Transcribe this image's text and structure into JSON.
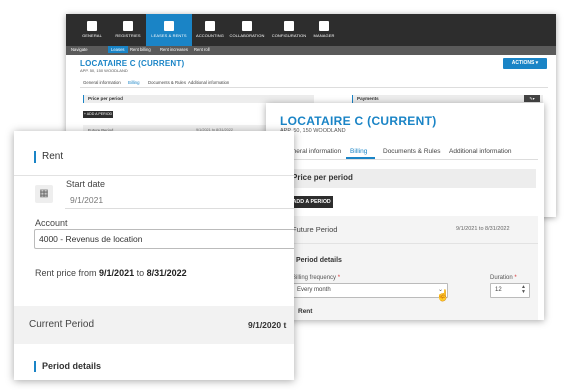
{
  "back_window": {
    "nav": [
      {
        "label": "GENERAL",
        "icon": "monitor-icon"
      },
      {
        "label": "REGISTRIES",
        "icon": "folder-icon"
      },
      {
        "label": "LEASES & RENTS",
        "icon": "lease-icon"
      },
      {
        "label": "ACCOUNTING",
        "icon": "document-icon"
      },
      {
        "label": "COLLABORATION",
        "icon": "collaboration-icon"
      },
      {
        "label": "CONFIGURATION",
        "icon": "gear-icon"
      },
      {
        "label": "MANAGER",
        "icon": "user-icon"
      }
    ],
    "subnav": [
      "Navigate",
      "Leases",
      "Rent billing",
      "Rent increases",
      "Rent roll"
    ],
    "title": "LOCATAIRE C (CURRENT)",
    "subtitle": "APP. 50, 150 WOODLAND",
    "actions_label": "ACTIONS",
    "tabs": [
      "General information",
      "Billing",
      "Documents & Rules",
      "Additional information"
    ],
    "price_per_period": "Price per period",
    "payments": "Payments",
    "add_period": "ADD A PERIOD",
    "future_period": "Future Period",
    "future_dates": "9/1/2021 to 8/31/2022"
  },
  "mid_window": {
    "title": "LOCATAIRE C (CURRENT)",
    "subtitle": "APP. 50, 150 WOODLAND",
    "tabs": [
      "General information",
      "Billing",
      "Documents & Rules",
      "Additional information"
    ],
    "price_per_period": "Price per period",
    "add_period": "+ ADD A PERIOD",
    "future_period": "Future Period",
    "future_dates": "9/1/2021 to 8/31/2022",
    "period_details": "Period details",
    "billing_frequency_label": "Billing frequency",
    "billing_frequency_value": "Every month",
    "duration_label": "Duration",
    "duration_value": "12",
    "rent": "Rent",
    "required_mark": "*"
  },
  "front_window": {
    "rent": "Rent",
    "start_date_label": "Start date",
    "start_date_value": "9/1/2021",
    "account_label": "Account",
    "account_value": "4000 - Revenus de location",
    "price_prefix": "Rent price from",
    "price_from": "9/1/2021",
    "price_to_word": "to",
    "price_to": "8/31/2022",
    "current_period": "Current Period",
    "current_dates": "9/1/2020 t",
    "period_details": "Period details"
  },
  "colors": {
    "accent": "#1a84c6",
    "dark_nav": "#2d2d2d",
    "required": "#d32f2f"
  }
}
